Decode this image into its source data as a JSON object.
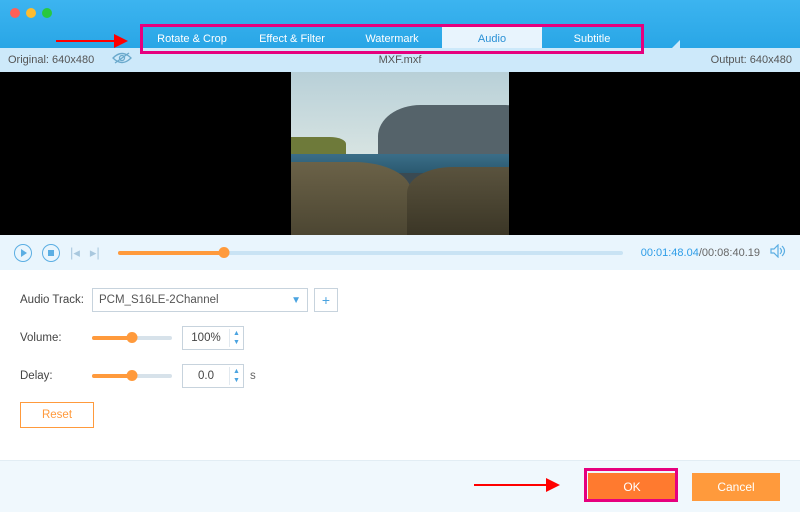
{
  "tabs": {
    "items": [
      "Rotate & Crop",
      "Effect & Filter",
      "Watermark",
      "Audio",
      "Subtitle"
    ],
    "active_index": 3
  },
  "info": {
    "original_label": "Original: 640x480",
    "filename": "MXF.mxf",
    "output_label": "Output: 640x480"
  },
  "playback": {
    "current_time": "00:01:48.04",
    "total_time": "/00:08:40.19",
    "progress_pct": 21
  },
  "audio": {
    "track_label": "Audio Track:",
    "track_value": "PCM_S16LE-2Channel",
    "volume_label": "Volume:",
    "volume_value": "100%",
    "volume_slider_pct": 50,
    "delay_label": "Delay:",
    "delay_value": "0.0",
    "delay_unit": "s",
    "delay_slider_pct": 50
  },
  "buttons": {
    "reset": "Reset",
    "ok": "OK",
    "cancel": "Cancel"
  },
  "colors": {
    "accent_blue": "#29a6e6",
    "accent_orange": "#ff9a3c",
    "highlight_magenta": "#e6007e",
    "arrow_red": "#ff0000"
  }
}
